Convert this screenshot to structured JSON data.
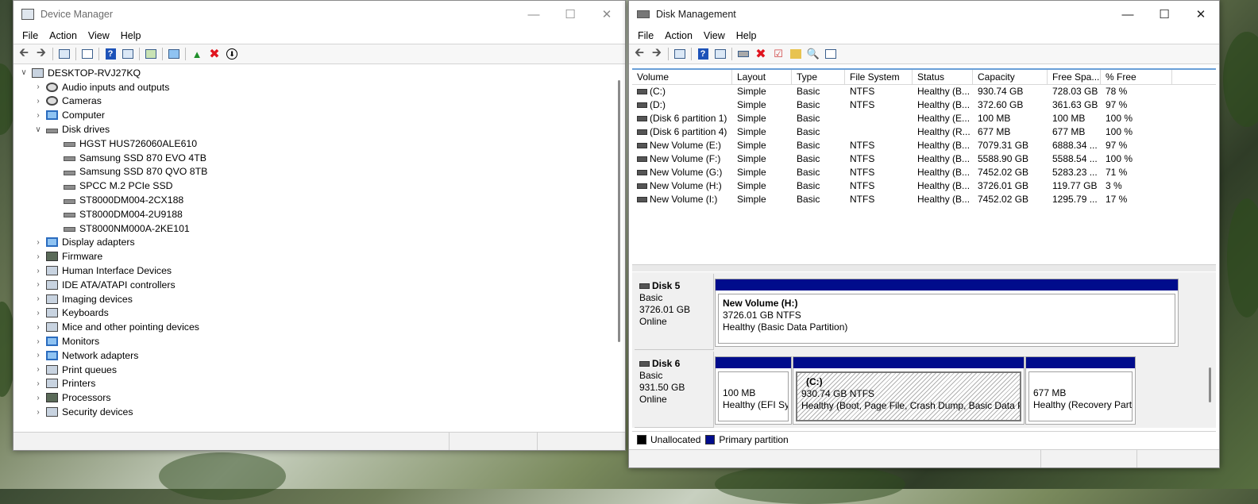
{
  "device_manager": {
    "title": "Device Manager",
    "menu": [
      "File",
      "Action",
      "View",
      "Help"
    ],
    "root": "DESKTOP-RVJ27KQ",
    "tree": [
      {
        "label": "Audio inputs and outputs",
        "expanded": false,
        "level": 1,
        "icon": "speaker-icon"
      },
      {
        "label": "Cameras",
        "expanded": false,
        "level": 1,
        "icon": "camera-icon"
      },
      {
        "label": "Computer",
        "expanded": false,
        "level": 1,
        "icon": "monitor-icon"
      },
      {
        "label": "Disk drives",
        "expanded": true,
        "level": 1,
        "icon": "disk-drive-icon"
      },
      {
        "label": "HGST HUS726060ALE610",
        "level": 2,
        "icon": "disk-drive-icon"
      },
      {
        "label": "Samsung SSD 870 EVO 4TB",
        "level": 2,
        "icon": "disk-drive-icon"
      },
      {
        "label": "Samsung SSD 870 QVO 8TB",
        "level": 2,
        "icon": "disk-drive-icon"
      },
      {
        "label": "SPCC M.2 PCIe SSD",
        "level": 2,
        "icon": "disk-drive-icon"
      },
      {
        "label": "ST8000DM004-2CX188",
        "level": 2,
        "icon": "disk-drive-icon"
      },
      {
        "label": "ST8000DM004-2U9188",
        "level": 2,
        "icon": "disk-drive-icon"
      },
      {
        "label": "ST8000NM000A-2KE101",
        "level": 2,
        "icon": "disk-drive-icon"
      },
      {
        "label": "Display adapters",
        "expanded": false,
        "level": 1,
        "icon": "display-adapter-icon"
      },
      {
        "label": "Firmware",
        "expanded": false,
        "level": 1,
        "icon": "chip-icon"
      },
      {
        "label": "Human Interface Devices",
        "expanded": false,
        "level": 1,
        "icon": "hid-icon"
      },
      {
        "label": "IDE ATA/ATAPI controllers",
        "expanded": false,
        "level": 1,
        "icon": "controller-icon"
      },
      {
        "label": "Imaging devices",
        "expanded": false,
        "level": 1,
        "icon": "scanner-icon"
      },
      {
        "label": "Keyboards",
        "expanded": false,
        "level": 1,
        "icon": "keyboard-icon"
      },
      {
        "label": "Mice and other pointing devices",
        "expanded": false,
        "level": 1,
        "icon": "mouse-icon"
      },
      {
        "label": "Monitors",
        "expanded": false,
        "level": 1,
        "icon": "monitor-icon"
      },
      {
        "label": "Network adapters",
        "expanded": false,
        "level": 1,
        "icon": "network-icon"
      },
      {
        "label": "Print queues",
        "expanded": false,
        "level": 1,
        "icon": "printer-icon"
      },
      {
        "label": "Printers",
        "expanded": false,
        "level": 1,
        "icon": "printer-icon"
      },
      {
        "label": "Processors",
        "expanded": false,
        "level": 1,
        "icon": "chip-icon"
      },
      {
        "label": "Security devices",
        "expanded": false,
        "level": 1,
        "icon": "security-icon"
      }
    ]
  },
  "disk_management": {
    "title": "Disk Management",
    "menu": [
      "File",
      "Action",
      "View",
      "Help"
    ],
    "columns": [
      "Volume",
      "Layout",
      "Type",
      "File System",
      "Status",
      "Capacity",
      "Free Spa...",
      "% Free"
    ],
    "volumes": [
      [
        "(C:)",
        "Simple",
        "Basic",
        "NTFS",
        "Healthy (B...",
        "930.74 GB",
        "728.03 GB",
        "78 %"
      ],
      [
        "(D:)",
        "Simple",
        "Basic",
        "NTFS",
        "Healthy (B...",
        "372.60 GB",
        "361.63 GB",
        "97 %"
      ],
      [
        "(Disk 6 partition 1)",
        "Simple",
        "Basic",
        "",
        "Healthy (E...",
        "100 MB",
        "100 MB",
        "100 %"
      ],
      [
        "(Disk 6 partition 4)",
        "Simple",
        "Basic",
        "",
        "Healthy (R...",
        "677 MB",
        "677 MB",
        "100 %"
      ],
      [
        "New Volume (E:)",
        "Simple",
        "Basic",
        "NTFS",
        "Healthy (B...",
        "7079.31 GB",
        "6888.34 ...",
        "97 %"
      ],
      [
        "New Volume (F:)",
        "Simple",
        "Basic",
        "NTFS",
        "Healthy (B...",
        "5588.90 GB",
        "5588.54 ...",
        "100 %"
      ],
      [
        "New Volume (G:)",
        "Simple",
        "Basic",
        "NTFS",
        "Healthy (B...",
        "7452.02 GB",
        "5283.23 ...",
        "71 %"
      ],
      [
        "New Volume (H:)",
        "Simple",
        "Basic",
        "NTFS",
        "Healthy (B...",
        "3726.01 GB",
        "119.77 GB",
        "3 %"
      ],
      [
        "New Volume (I:)",
        "Simple",
        "Basic",
        "NTFS",
        "Healthy (B...",
        "7452.02 GB",
        "1295.79 ...",
        "17 %"
      ]
    ],
    "disks": [
      {
        "name": "Disk 5",
        "type": "Basic",
        "size": "3726.01 GB",
        "state": "Online",
        "partitions": [
          {
            "title": "New Volume  (H:)",
            "line1": "3726.01 GB NTFS",
            "line2": "Healthy (Basic Data Partition)",
            "hatched": false
          }
        ]
      },
      {
        "name": "Disk 6",
        "type": "Basic",
        "size": "931.50 GB",
        "state": "Online",
        "partitions": [
          {
            "title": "",
            "line1": "100 MB",
            "line2": "Healthy (EFI Sys",
            "hatched": false
          },
          {
            "title": "(C:)",
            "line1": "930.74 GB NTFS",
            "line2": "Healthy (Boot, Page File, Crash Dump, Basic Data Part",
            "hatched": true
          },
          {
            "title": "",
            "line1": "677 MB",
            "line2": "Healthy (Recovery Partit",
            "hatched": false
          }
        ]
      }
    ],
    "legend": [
      {
        "label": "Unallocated",
        "color": "#000000"
      },
      {
        "label": "Primary partition",
        "color": "#000c8c"
      }
    ]
  },
  "colors": {
    "partition_band": "#000c8c",
    "selection_accent": "#6aa0d8"
  }
}
